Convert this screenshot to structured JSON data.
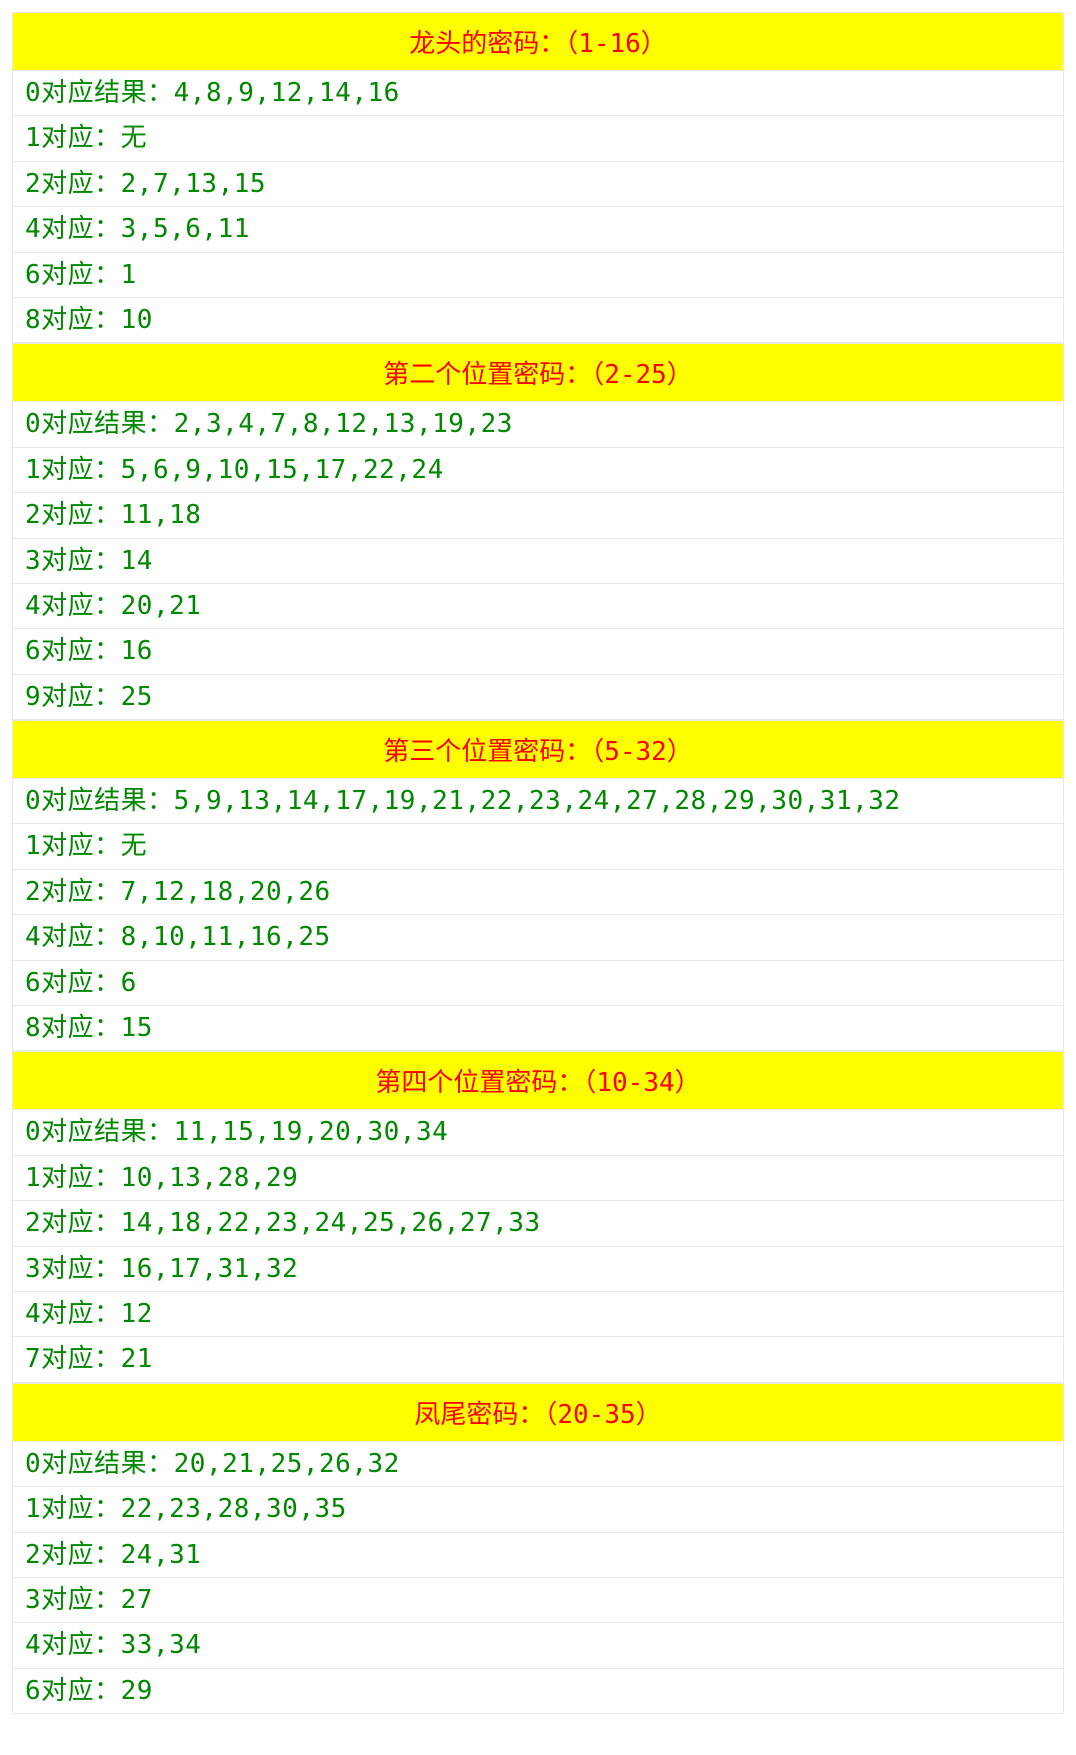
{
  "sections": [
    {
      "title": "龙头的密码：（1-16）",
      "rows": [
        "0对应结果：4,8,9,12,14,16",
        "1对应：无",
        "2对应：2,7,13,15",
        "4对应：3,5,6,11",
        "6对应：1",
        "8对应：10"
      ]
    },
    {
      "title": "第二个位置密码：（2-25）",
      "rows": [
        "0对应结果：2,3,4,7,8,12,13,19,23",
        "1对应：5,6,9,10,15,17,22,24",
        "2对应：11,18",
        "3对应：14",
        "4对应：20,21",
        "6对应：16",
        "9对应：25"
      ]
    },
    {
      "title": "第三个位置密码：（5-32）",
      "rows": [
        "0对应结果：5,9,13,14,17,19,21,22,23,24,27,28,29,30,31,32",
        "1对应：无",
        "2对应：7,12,18,20,26",
        "4对应：8,10,11,16,25",
        "6对应：6",
        "8对应：15"
      ]
    },
    {
      "title": "第四个位置密码：（10-34）",
      "rows": [
        "0对应结果：11,15,19,20,30,34",
        "1对应：10,13,28,29",
        "2对应：14,18,22,23,24,25,26,27,33",
        "3对应：16,17,31,32",
        "4对应：12",
        "7对应：21"
      ]
    },
    {
      "title": "凤尾密码：（20-35）",
      "rows": [
        "0对应结果：20,21,25,26,32",
        "1对应：22,23,28,30,35",
        "2对应：24,31",
        "3对应：27",
        "4对应：33,34",
        "6对应：29"
      ]
    }
  ]
}
